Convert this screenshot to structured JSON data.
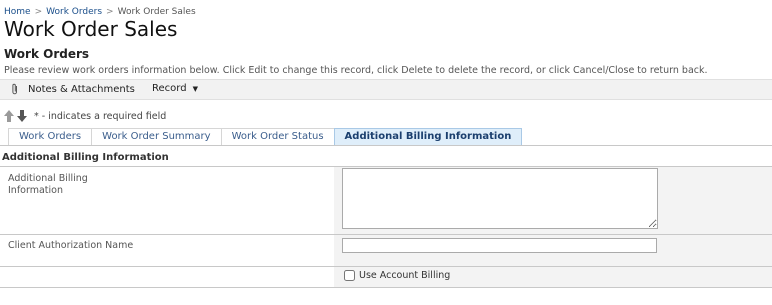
{
  "breadcrumb": {
    "home": "Home",
    "sep1": ">",
    "work_orders": "Work Orders",
    "sep2": ">",
    "current": "Work Order Sales"
  },
  "page": {
    "title": "Work Order Sales",
    "section_title": "Work Orders",
    "instructions": "Please review work orders information below. Click Edit to change this record, click Delete to delete the record, or click Cancel/Close to return back."
  },
  "toolbar": {
    "notes_label": "Notes & Attachments",
    "notes_icon": "paperclip-icon",
    "record_label": "Record",
    "record_icon": "caret-down-icon"
  },
  "required_note": {
    "up_icon": "arrow-up-icon",
    "down_icon": "arrow-down-icon",
    "text": "* - indicates a required field"
  },
  "tabs": [
    {
      "label": "Work Orders",
      "active": false
    },
    {
      "label": "Work Order Summary",
      "active": false
    },
    {
      "label": "Work Order Status",
      "active": false
    },
    {
      "label": "Additional Billing Information",
      "active": true
    }
  ],
  "section": {
    "heading": "Additional Billing Information",
    "fields": {
      "additional_billing": {
        "label": "Additional Billing Information",
        "value": ""
      },
      "client_authorization": {
        "label": "Client Authorization Name",
        "value": ""
      },
      "use_account_billing": {
        "label": "Use Account Billing",
        "checked": false
      }
    }
  },
  "colors": {
    "link": "#1a4e8a",
    "active_tab_bg": "#dfeefa",
    "value_cell_bg": "#f3f3f3"
  }
}
